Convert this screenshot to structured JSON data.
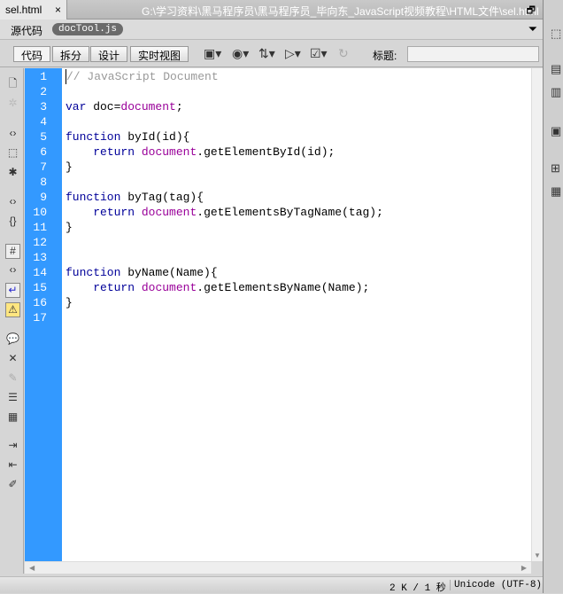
{
  "tab": {
    "filename": "sel.html",
    "close": "×",
    "path": "G:\\学习资料\\黑马程序员\\黑马程序员_毕向东_JavaScript视频教程\\HTML文件\\sel.html",
    "restore": "🗗"
  },
  "source_bar": {
    "label": "源代码",
    "related_file": "docTool.js",
    "filter": "⏷"
  },
  "toolbar": {
    "views": [
      "代码",
      "拆分",
      "设计",
      "实时视图"
    ],
    "title_label": "标题:",
    "title_value": ""
  },
  "editor": {
    "line_numbers": [
      "1",
      "2",
      "3",
      "4",
      "5",
      "6",
      "7",
      "8",
      "9",
      "10",
      "11",
      "12",
      "13",
      "14",
      "15",
      "16",
      "17"
    ],
    "lines": [
      [
        [
          "cm",
          "// JavaScript Document"
        ]
      ],
      [],
      [
        [
          "kw",
          "var"
        ],
        [
          "pl",
          " doc="
        ],
        [
          "doc",
          "document"
        ],
        [
          "pl",
          ";"
        ]
      ],
      [],
      [
        [
          "kw",
          "function"
        ],
        [
          "pl",
          " byId(id){"
        ]
      ],
      [
        [
          "pl",
          "    "
        ],
        [
          "kw",
          "return"
        ],
        [
          "pl",
          " "
        ],
        [
          "doc",
          "document"
        ],
        [
          "pl",
          ".getElementById(id);"
        ]
      ],
      [
        [
          "pl",
          "}"
        ]
      ],
      [],
      [
        [
          "kw",
          "function"
        ],
        [
          "pl",
          " byTag(tag){"
        ]
      ],
      [
        [
          "pl",
          "    "
        ],
        [
          "kw",
          "return"
        ],
        [
          "pl",
          " "
        ],
        [
          "doc",
          "document"
        ],
        [
          "pl",
          ".getElementsByTagName(tag);"
        ]
      ],
      [
        [
          "pl",
          "}"
        ]
      ],
      [],
      [],
      [
        [
          "kw",
          "function"
        ],
        [
          "pl",
          " byName(Name){"
        ]
      ],
      [
        [
          "pl",
          "    "
        ],
        [
          "kw",
          "return"
        ],
        [
          "pl",
          " "
        ],
        [
          "doc",
          "document"
        ],
        [
          "pl",
          ".getElementsByName(Name);"
        ]
      ],
      [
        [
          "pl",
          "}"
        ]
      ],
      []
    ]
  },
  "status": {
    "size": "2 K / 1 秒",
    "encoding": "Unicode (UTF-8)"
  }
}
